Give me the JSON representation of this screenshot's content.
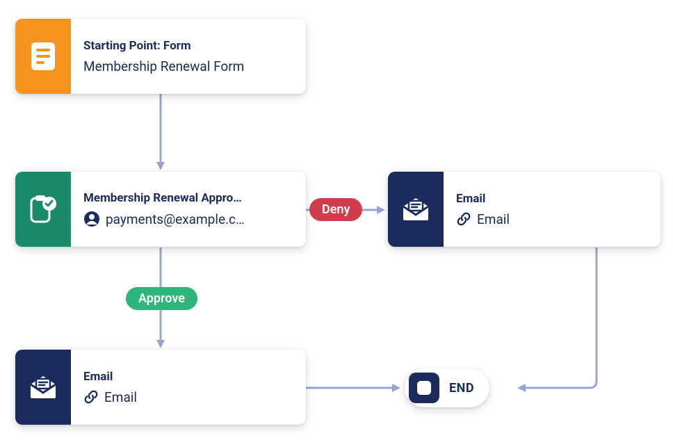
{
  "nodes": {
    "start": {
      "title": "Starting Point: Form",
      "subtitle": "Membership Renewal Form",
      "icon": "form-icon",
      "accent": "#f7941e"
    },
    "approval": {
      "title": "Membership Renewal Appro…",
      "subtitle": "payments@example.c…",
      "sub_icon": "user-icon",
      "icon": "approval-icon",
      "accent": "#1a8b6a"
    },
    "email_deny": {
      "title": "Email",
      "subtitle": "Email",
      "sub_icon": "link-icon",
      "icon": "email-icon",
      "accent": "#1a2b5c"
    },
    "email_approve": {
      "title": "Email",
      "subtitle": "Email",
      "sub_icon": "link-icon",
      "icon": "email-icon",
      "accent": "#1a2b5c"
    },
    "end": {
      "label": "END",
      "icon": "stop-icon"
    }
  },
  "pills": {
    "deny": "Deny",
    "approve": "Approve"
  },
  "edges": [
    {
      "from": "start",
      "to": "approval",
      "label": null
    },
    {
      "from": "approval",
      "to": "email_deny",
      "label": "Deny"
    },
    {
      "from": "approval",
      "to": "email_approve",
      "label": "Approve"
    },
    {
      "from": "email_approve",
      "to": "end",
      "label": null
    },
    {
      "from": "email_deny",
      "to": "end",
      "label": null
    }
  ]
}
